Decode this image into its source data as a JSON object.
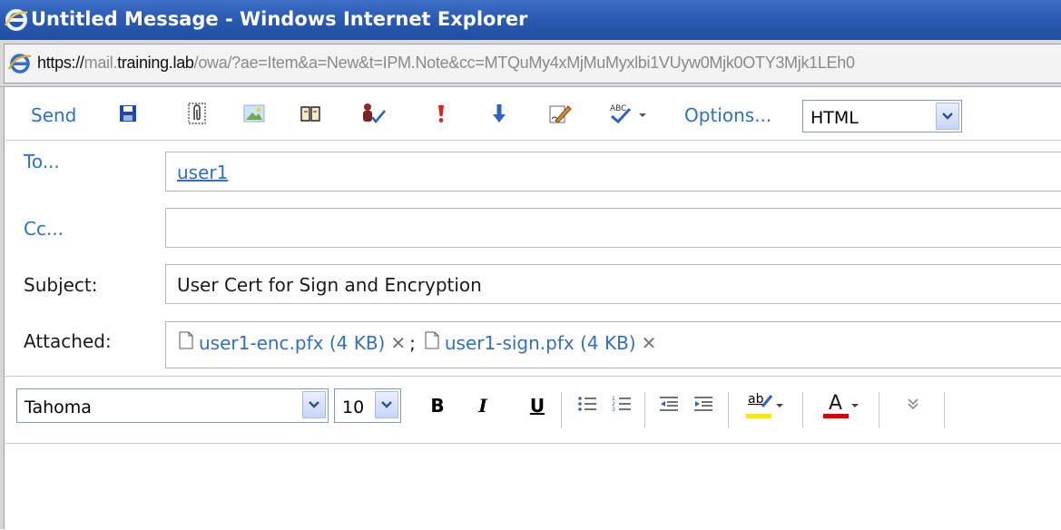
{
  "window": {
    "title": "Untitled Message - Windows Internet Explorer",
    "icon": "ie-icon"
  },
  "address": {
    "scheme": "https://",
    "sub": "mail.",
    "domain": "training.lab",
    "path": "/owa/?ae=Item&a=New&t=IPM.Note&cc=MTQuMy4xMjMuMyxlbi1VUyw0Mjk0OTY3Mjk1LEh0"
  },
  "toolbar": {
    "send_label": "Send",
    "options_label": "Options...",
    "format_value": "HTML"
  },
  "header": {
    "to_label": "To...",
    "to_value": "user1",
    "cc_label": "Cc...",
    "cc_value": "",
    "subject_label": "Subject:",
    "subject_value": "User Cert for Sign and Encryption",
    "attached_label": "Attached:",
    "attachments": [
      {
        "name": "user1-enc.pfx (4 KB)"
      },
      {
        "name": "user1-sign.pfx (4 KB)"
      }
    ],
    "attachment_separator": ";"
  },
  "format": {
    "font_value": "Tahoma",
    "size_value": "10",
    "bold": "B",
    "italic": "I",
    "underline": "U",
    "highlight_glyph": "ab",
    "fontcolor_glyph": "A"
  },
  "colors": {
    "link": "#2f6fc4",
    "titlebar": "#2b5bb3",
    "highlight": "#ffe600",
    "fontcolor": "#e00000"
  }
}
